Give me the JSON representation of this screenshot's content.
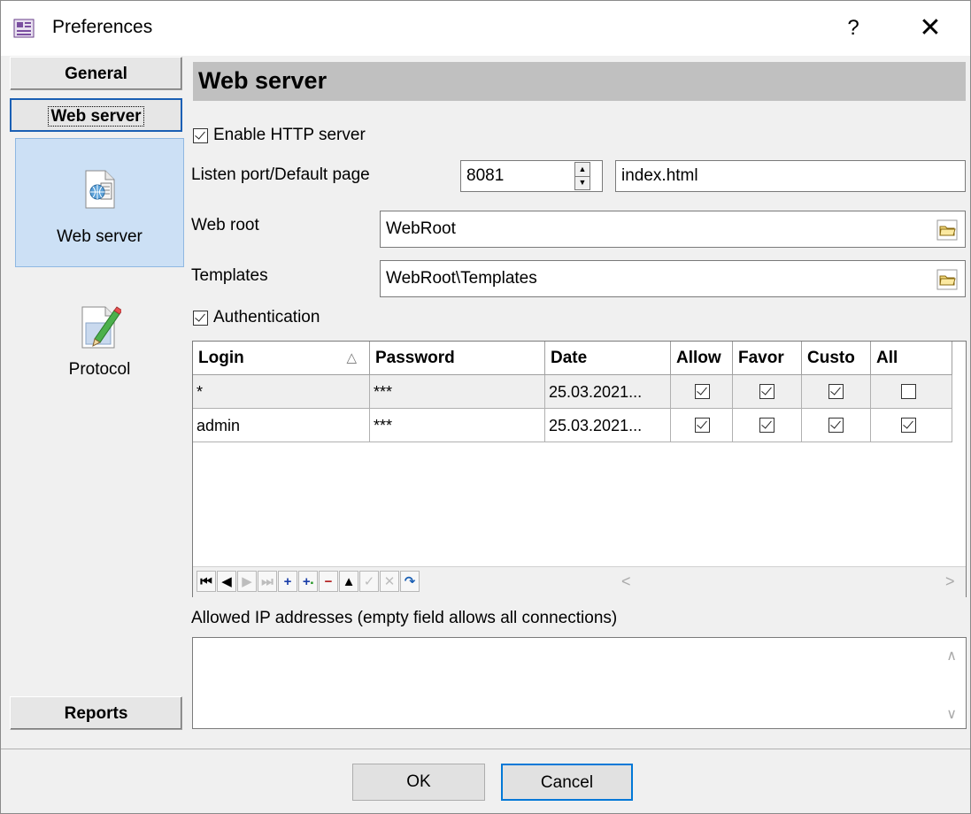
{
  "window": {
    "title": "Preferences",
    "help": "?",
    "close": "✕"
  },
  "sidebar": {
    "general": "General",
    "web_server_group": "Web server",
    "items": [
      {
        "label": "Web server",
        "icon": "web-page-icon"
      },
      {
        "label": "Protocol",
        "icon": "protocol-pencil-icon"
      }
    ],
    "reports": "Reports"
  },
  "main": {
    "header": "Web server",
    "enable_http": {
      "label": "Enable HTTP server",
      "checked": true
    },
    "listen": {
      "label": "Listen port/Default page",
      "port": "8081",
      "page": "index.html"
    },
    "web_root": {
      "label": "Web root",
      "value": "WebRoot"
    },
    "templates": {
      "label": "Templates",
      "value": "WebRoot\\Templates"
    },
    "authentication": {
      "label": "Authentication",
      "checked": true
    },
    "grid": {
      "columns": [
        "Login",
        "Password",
        "Date",
        "Allow",
        "Favor",
        "Custo",
        "All"
      ],
      "sort_indicator": "△",
      "rows": [
        {
          "login": "*",
          "password": "***",
          "date": "25.03.2021...",
          "allow": true,
          "favor": true,
          "custo": true,
          "all": false
        },
        {
          "login": "admin",
          "password": "***",
          "date": "25.03.2021...",
          "allow": true,
          "favor": true,
          "custo": true,
          "all": true
        }
      ],
      "navigator": [
        "first",
        "prior",
        "next",
        "last",
        "insert",
        "append",
        "delete",
        "edit",
        "post",
        "cancel",
        "refresh"
      ],
      "hscroll_left": "<",
      "hscroll_right": ">"
    },
    "allowed_ip": {
      "label": "Allowed IP addresses (empty field allows all connections)",
      "value": ""
    }
  },
  "footer": {
    "ok": "OK",
    "cancel": "Cancel"
  },
  "colors": {
    "accent": "#0078d7",
    "selected_bg": "#cce0f5",
    "header_bg": "#c0c0c0"
  }
}
